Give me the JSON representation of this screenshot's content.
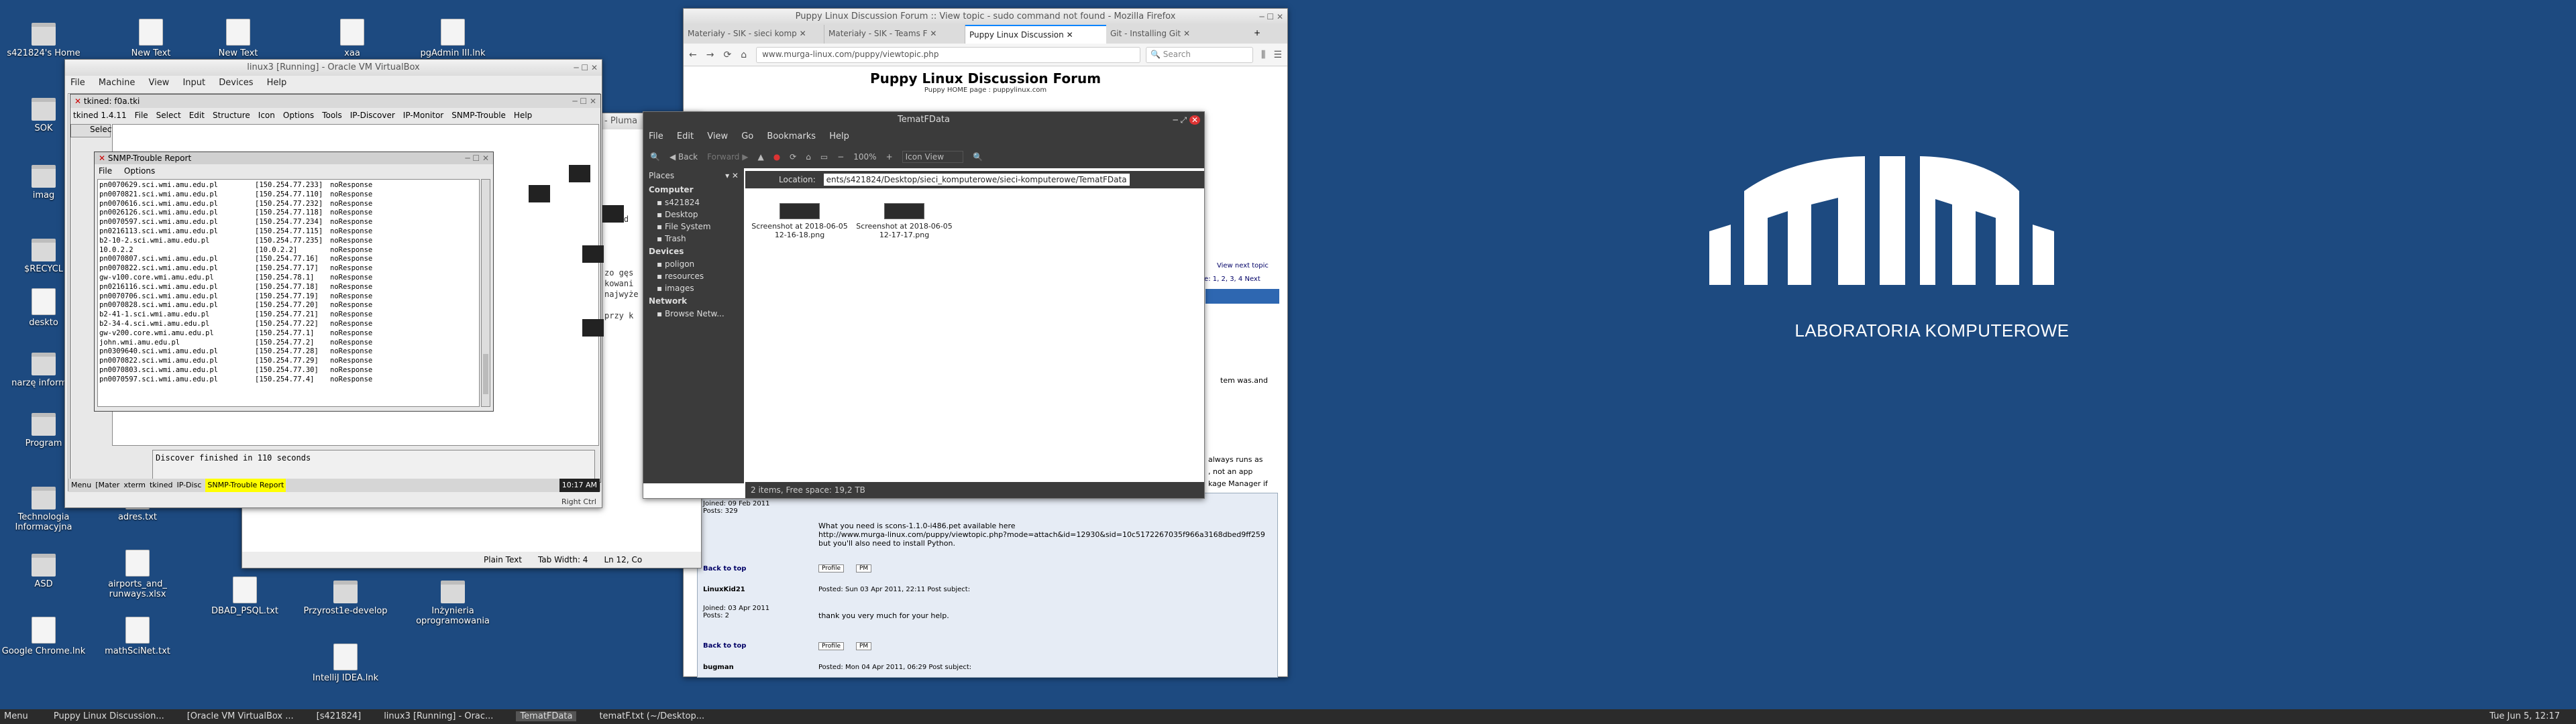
{
  "desktop": {
    "icons": [
      "s421824's Home",
      "New Text",
      "New Text",
      "xaa",
      "pgAdmin III.lnk",
      "SOK",
      "imag",
      "$RECYCL",
      "deskto",
      "narzę informat",
      "Program",
      "Technologia Informacyjna",
      "adres.txt",
      "ASD",
      "airports_and_ runways.xlsx",
      "DBAD_PSQL.txt",
      "Przyrost1e-develop",
      "Inżynieria oprogramowania",
      "Google Chrome.lnk",
      "mathSciNet.txt",
      "IntelliJ IDEA.lnk"
    ],
    "logo_text": "LABORATORIA KOMPUTEROWE"
  },
  "vbox": {
    "title": "linux3 [Running] - Oracle VM VirtualBox",
    "menu": [
      "File",
      "Machine",
      "View",
      "Input",
      "Devices",
      "Help"
    ]
  },
  "tkined": {
    "title": "tkined: f0a.tki",
    "menu": [
      "tkined 1.4.11",
      "File",
      "Select",
      "Edit",
      "Structure",
      "Icon",
      "Options",
      "Tools",
      "IP-Discover",
      "IP-Monitor",
      "SNMP-Trouble",
      "Help"
    ],
    "select": "Select"
  },
  "snmp": {
    "title": "SNMP-Trouble Report",
    "menu": [
      "File",
      "Options"
    ],
    "rows": [
      [
        "pn0070629.sci.wmi.amu.edu.pl",
        "[150.254.77.233]",
        "noResponse"
      ],
      [
        "pn0070821.sci.wmi.amu.edu.pl",
        "[150.254.77.110]",
        "noResponse"
      ],
      [
        "pn0070616.sci.wmi.amu.edu.pl",
        "[150.254.77.232]",
        "noResponse"
      ],
      [
        "pn0026126.sci.wmi.amu.edu.pl",
        "[150.254.77.118]",
        "noResponse"
      ],
      [
        "pn0070597.sci.wmi.amu.edu.pl",
        "[150.254.77.234]",
        "noResponse"
      ],
      [
        "pn0216113.sci.wmi.amu.edu.pl",
        "[150.254.77.115]",
        "noResponse"
      ],
      [
        "b2-10-2.sci.wmi.amu.edu.pl",
        "[150.254.77.235]",
        "noResponse"
      ],
      [
        "10.0.2.2",
        "[10.0.2.2]",
        "noResponse"
      ],
      [
        "pn0070807.sci.wmi.amu.edu.pl",
        "[150.254.77.16]",
        "noResponse"
      ],
      [
        "pn0070822.sci.wmi.amu.edu.pl",
        "[150.254.77.17]",
        "noResponse"
      ],
      [
        "gw-v100.core.wmi.amu.edu.pl",
        "[150.254.78.1]",
        "noResponse"
      ],
      [
        "pn0216116.sci.wmi.amu.edu.pl",
        "[150.254.77.18]",
        "noResponse"
      ],
      [
        "pn0070706.sci.wmi.amu.edu.pl",
        "[150.254.77.19]",
        "noResponse"
      ],
      [
        "pn0070828.sci.wmi.amu.edu.pl",
        "[150.254.77.20]",
        "noResponse"
      ],
      [
        "b2-41-1.sci.wmi.amu.edu.pl",
        "[150.254.77.21]",
        "noResponse"
      ],
      [
        "b2-34-4.sci.wmi.amu.edu.pl",
        "[150.254.77.22]",
        "noResponse"
      ],
      [
        "gw-v200.core.wmi.amu.edu.pl",
        "[150.254.77.1]",
        "noResponse"
      ],
      [
        "john.wmi.amu.edu.pl",
        "[150.254.77.2]",
        "noResponse"
      ],
      [
        "pn0309640.sci.wmi.amu.edu.pl",
        "[150.254.77.28]",
        "noResponse"
      ],
      [
        "pn0070822.sci.wmi.amu.edu.pl",
        "[150.254.77.29]",
        "noResponse"
      ],
      [
        "pn0070803.sci.wmi.amu.edu.pl",
        "[150.254.77.30]",
        "noResponse"
      ],
      [
        "pn0070597.sci.wmi.amu.edu.pl",
        "[150.254.77.4]",
        "noResponse"
      ]
    ],
    "status": "Discover finished in 110 seconds"
  },
  "vmtaskbar": {
    "items": [
      "Menu",
      "[Mater",
      "xterm",
      "tkined",
      "IP-Disc",
      "SNMP-Trouble Report"
    ],
    "time": "10:17 AM",
    "hostkey": "Right Ctrl"
  },
  "firefox": {
    "title": "Puppy Linux Discussion Forum :: View topic - sudo command not found - Mozilla Firefox",
    "tabs": [
      "Materiały - SIK - sieci komp",
      "Materiały - SIK - Teams F",
      "Puppy Linux Discussion",
      "Git - Installing Git"
    ],
    "url": "www.murga-linux.com/puppy/viewtopic.php",
    "search": "Search",
    "heading": "Puppy Linux Discussion Forum",
    "sub": "Puppy HOME page : puppylinux.com",
    "posts": [
      {
        "meta": "Joined: 09 Feb 2011\nPosts: 329",
        "body": "What you need is scons-1.1.0-i486.pet available here\nhttp://www.murga-linux.com/puppy/viewtopic.php?mode=attach&id=12930&sid=10c5172267035f966a3168dbed9ff259\nbut you'll also need to install Python."
      },
      {
        "author": "LinuxKid21",
        "meta": "Joined: 03 Apr 2011\nPosts: 2",
        "posted": "Posted: Sun 03 Apr 2011, 22:11   Post subject:",
        "body": "thank you very much for your help."
      },
      {
        "author": "bugman",
        "posted": "Posted: Mon 04 Apr 2011, 06:29   Post subject:"
      }
    ],
    "backtotop": "Back to top",
    "profile": "Profile",
    "pm": "PM",
    "side": "View next topic",
    "pages": "Page: 1, 2, 3, 4 Next",
    "side2": [
      "tem was.and",
      "always runs as",
      ", not an app",
      "kage Manager if"
    ]
  },
  "pluma": {
    "title": "- Pluma",
    "status": [
      "Plain Text",
      "Tab Width: 4",
      "Ln 12, Co"
    ]
  },
  "fm": {
    "title": "TematFData",
    "menu": [
      "File",
      "Edit",
      "View",
      "Go",
      "Bookmarks",
      "Help"
    ],
    "back": "Back",
    "forward": "Forward",
    "zoom": "100%",
    "view": "Icon View",
    "location_label": "Location:",
    "location": "ents/s421824/Desktop/sieci_komputerowe/sieci-komputerowe/TematFData",
    "places_label": "Places",
    "sections": [
      {
        "name": "Computer",
        "items": [
          "s421824",
          "Desktop",
          "File System",
          "Trash"
        ]
      },
      {
        "name": "Devices",
        "items": [
          "poligon",
          "resources",
          "images"
        ]
      },
      {
        "name": "Network",
        "items": [
          "Browse Netw..."
        ]
      }
    ],
    "files": [
      "Screenshot at 2018-06-05 12-16-18.png",
      "Screenshot at 2018-06-05 12-17-17.png"
    ],
    "status": "2 items, Free space: 19,2 TB"
  },
  "taskbar": {
    "menu": "Menu",
    "items": [
      "Puppy Linux Discussion...",
      "[Oracle VM VirtualBox ...",
      "[s421824]",
      "linux3 [Running] - Orac...",
      "TematFData",
      "tematF.txt (~/Desktop..."
    ],
    "clock": "Tue Jun 5, 12:17"
  }
}
